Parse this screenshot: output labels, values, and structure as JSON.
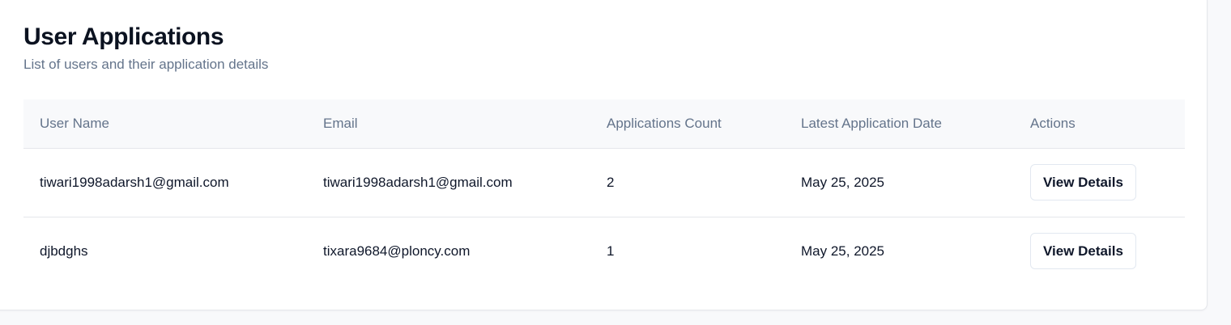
{
  "header": {
    "title": "User Applications",
    "subtitle": "List of users and their application details"
  },
  "table": {
    "columns": [
      "User Name",
      "Email",
      "Applications Count",
      "Latest Application Date",
      "Actions"
    ],
    "rows": [
      {
        "user_name": "tiwari1998adarsh1@gmail.com",
        "email": "tiwari1998adarsh1@gmail.com",
        "applications_count": "2",
        "latest_application_date": "May 25, 2025",
        "action_label": "View Details"
      },
      {
        "user_name": "djbdghs",
        "email": "tixara9684@ploncy.com",
        "applications_count": "1",
        "latest_application_date": "May 25, 2025",
        "action_label": "View Details"
      }
    ]
  },
  "colors": {
    "title": "#0b1220",
    "muted_text": "#64748b",
    "header_bg": "#f8f9fb",
    "border": "#e5e7eb"
  }
}
